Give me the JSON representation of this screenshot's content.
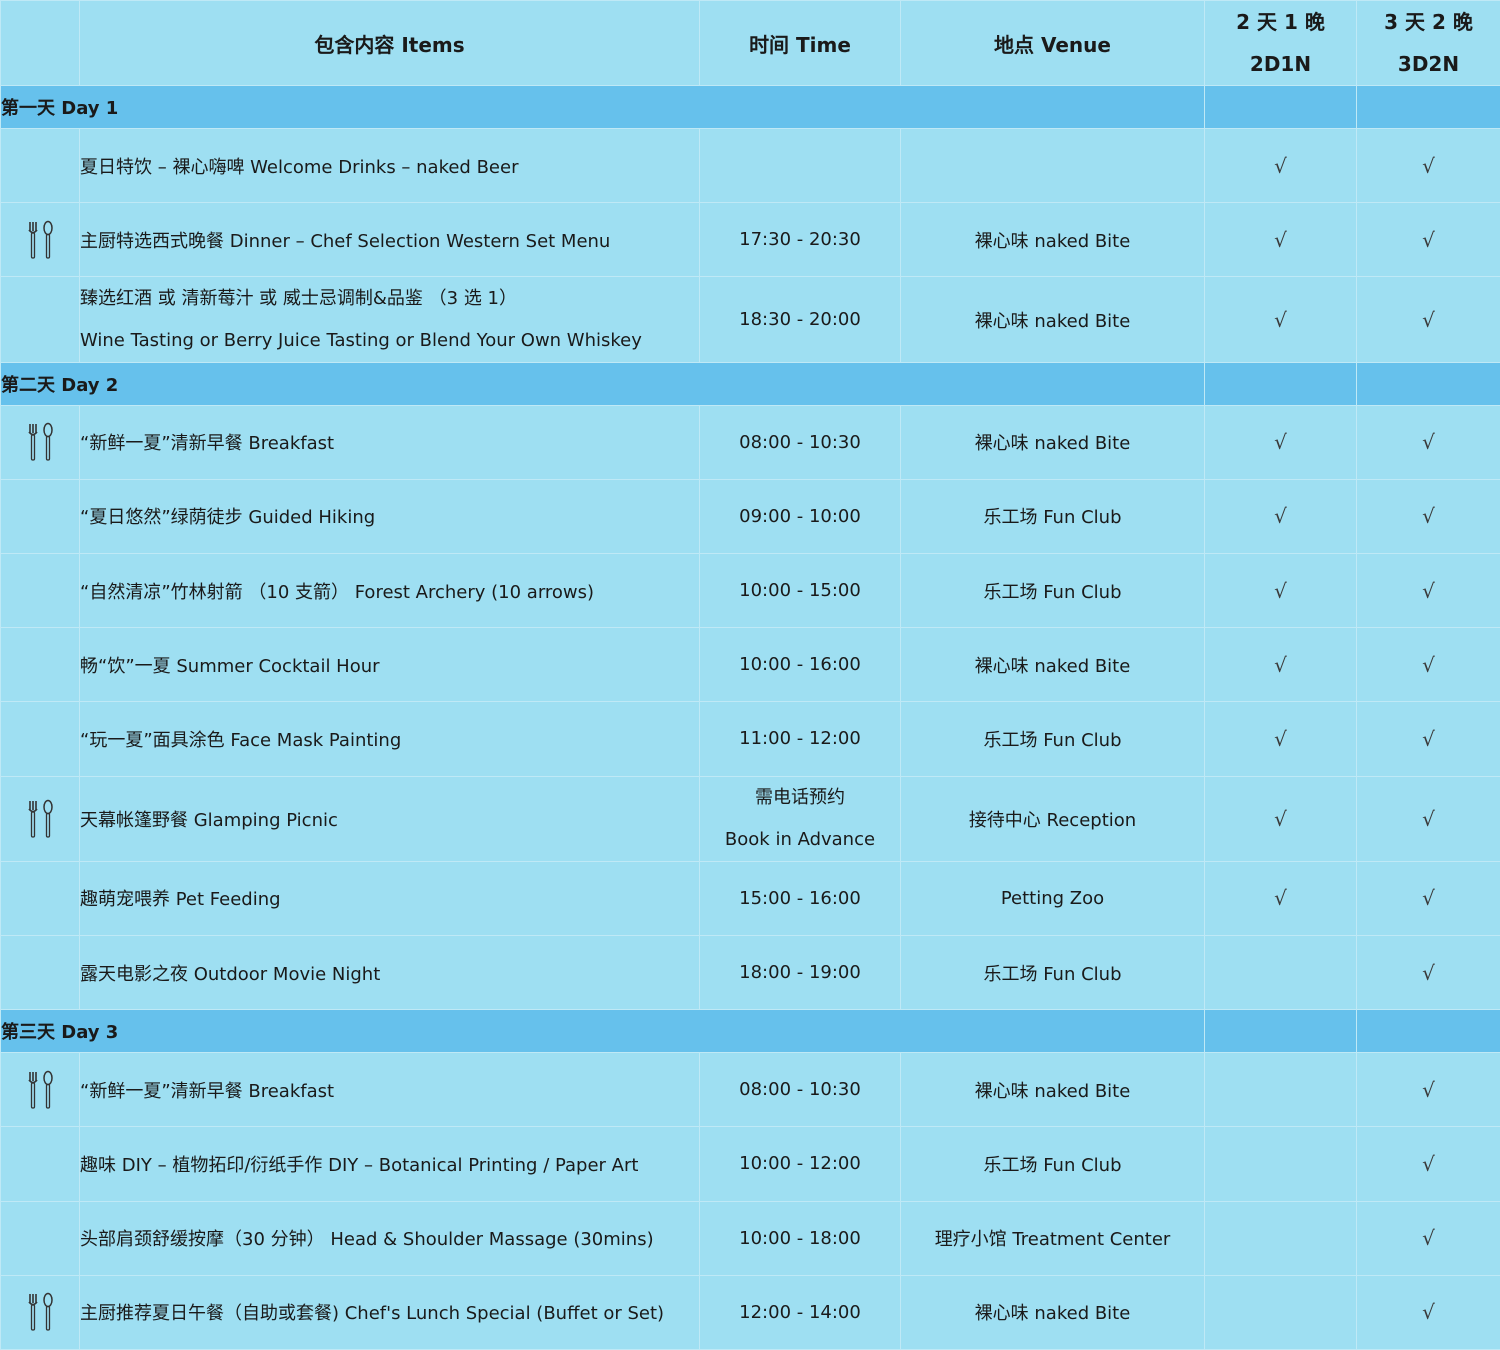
{
  "header": {
    "items": "包含内容 Items",
    "time": "时间 Time",
    "venue": "地点 Venue",
    "p1_line1": "2 天 1 晚",
    "p1_line2": "2D1N",
    "p2_line1": "3 天 2 晚",
    "p2_line2": "3D2N"
  },
  "check_mark": "√",
  "days": [
    {
      "label": "第一天  Day 1",
      "rows": [
        {
          "icon": "",
          "item": "夏日特饮 – 裸心嗨啤  Welcome Drinks – naked Beer",
          "time": "",
          "venue": "",
          "d1": "√",
          "d2": "√"
        },
        {
          "icon": "cutlery-icon",
          "item": "主厨特选西式晚餐  Dinner – Chef Selection Western Set Menu",
          "time": "17:30 - 20:30",
          "venue": "裸心味  naked Bite",
          "d1": "√",
          "d2": "√"
        },
        {
          "icon": "",
          "item": "臻选红酒 或 清新莓汁 或 威士忌调制&品鉴 （3 选 1）",
          "item_line2": "Wine Tasting or Berry Juice Tasting or Blend Your Own Whiskey",
          "time": "18:30 - 20:00",
          "venue": "裸心味  naked Bite",
          "d1": "√",
          "d2": "√"
        }
      ]
    },
    {
      "label": "第二天  Day 2",
      "rows": [
        {
          "icon": "cutlery-icon",
          "item": "“新鲜一夏”清新早餐  Breakfast",
          "time": "08:00 - 10:30",
          "venue": "裸心味  naked Bite",
          "d1": "√",
          "d2": "√"
        },
        {
          "icon": "",
          "item": "“夏日悠然”绿荫徒步  Guided Hiking",
          "time": "09:00 - 10:00",
          "venue": "乐工场  Fun Club",
          "d1": "√",
          "d2": "√"
        },
        {
          "icon": "",
          "item": "“自然清凉”竹林射箭 （10 支箭） Forest Archery (10 arrows)",
          "time": "10:00 - 15:00",
          "venue": "乐工场  Fun Club",
          "d1": "√",
          "d2": "√"
        },
        {
          "icon": "",
          "item": "畅“饮”一夏  Summer Cocktail Hour",
          "time": "10:00 - 16:00",
          "venue": "裸心味  naked Bite",
          "d1": "√",
          "d2": "√"
        },
        {
          "icon": "",
          "item": "“玩一夏”面具涂色  Face Mask Painting",
          "time": "11:00 - 12:00",
          "venue": "乐工场  Fun Club",
          "d1": "√",
          "d2": "√"
        },
        {
          "icon": "cutlery-icon",
          "item": "天幕帐篷野餐  Glamping Picnic",
          "time": "需电话预约",
          "time_line2": "Book in Advance",
          "venue": "接待中心 Reception",
          "d1": "√",
          "d2": "√"
        },
        {
          "icon": "",
          "item": "趣萌宠喂养  Pet Feeding",
          "time": "15:00 - 16:00",
          "venue": "Petting Zoo",
          "d1": "√",
          "d2": "√"
        },
        {
          "icon": "",
          "item": "露天电影之夜  Outdoor Movie Night",
          "time": "18:00 - 19:00",
          "venue": "乐工场 Fun Club",
          "d1": "",
          "d2": "√"
        }
      ]
    },
    {
      "label": "第三天  Day 3",
      "rows": [
        {
          "icon": "cutlery-icon",
          "item": "“新鲜一夏”清新早餐  Breakfast",
          "time": "08:00 - 10:30",
          "venue": "裸心味  naked Bite",
          "d1": "",
          "d2": "√"
        },
        {
          "icon": "",
          "item": "趣味 DIY – 植物拓印/衍纸手作  DIY – Botanical Printing / Paper Art",
          "time": "10:00 - 12:00",
          "venue": "乐工场  Fun Club",
          "d1": "",
          "d2": "√"
        },
        {
          "icon": "",
          "item": "头部肩颈舒缓按摩（30 分钟）   Head & Shoulder Massage (30mins)",
          "time": "10:00 - 18:00",
          "venue": "理疗小馆  Treatment Center",
          "d1": "",
          "d2": "√"
        },
        {
          "icon": "cutlery-icon",
          "item": "主厨推荐夏日午餐（自助或套餐) Chef's Lunch Special (Buffet or Set)",
          "time": "12:00 - 14:00",
          "venue": "裸心味  naked Bite",
          "d1": "",
          "d2": "√"
        }
      ]
    }
  ]
}
